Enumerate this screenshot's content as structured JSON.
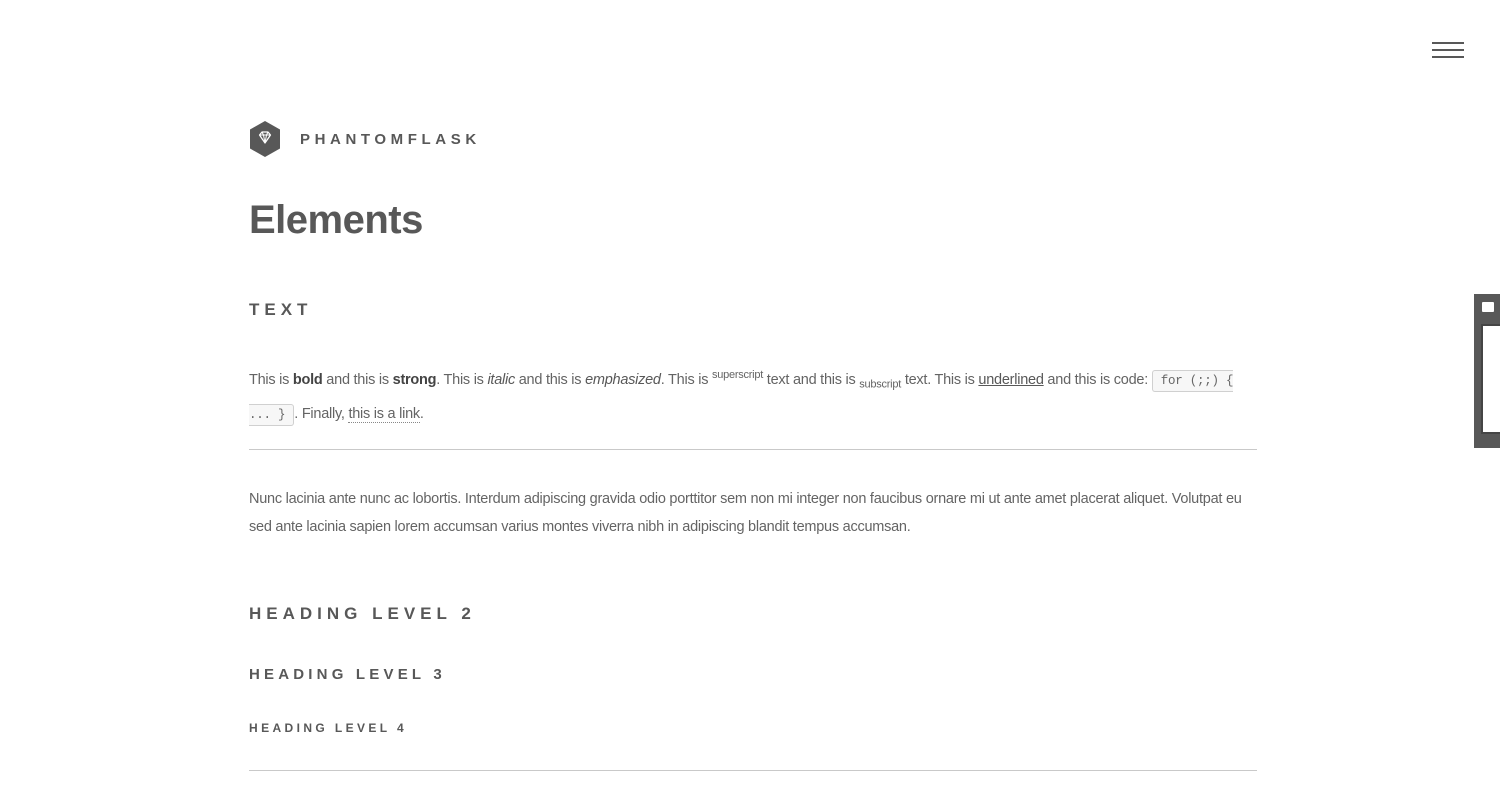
{
  "header": {
    "site_name": "PHANTOMFLASK",
    "logo_icon": "diamond-icon",
    "menu_icon": "hamburger-menu-icon"
  },
  "page_title": "Elements",
  "sections": {
    "text_heading": "TEXT",
    "text_paragraph": {
      "p1": "This is ",
      "bold": "bold",
      "p2": " and this is ",
      "strong": "strong",
      "p3": ". This is ",
      "italic": "italic",
      "p4": " and this is ",
      "emphasized": "emphasized",
      "p5": ". This is ",
      "superscript": "superscript",
      "p6": " text and this is ",
      "subscript": "subscript",
      "p7": " text. This is ",
      "underlined": "underlined",
      "p8": " and this is code: ",
      "code": "for (;;) { ... }",
      "p9": ". Finally, ",
      "link": "this is a link",
      "p10": "."
    },
    "lorem_paragraph": "Nunc lacinia ante nunc ac lobortis. Interdum adipiscing gravida odio porttitor sem non mi integer non faucibus ornare mi ut ante amet placerat aliquet. Volutpat eu sed ante lacinia sapien lorem accumsan varius montes viverra nibh in adipiscing blandit tempus accumsan.",
    "heading_2": "HEADING LEVEL 2",
    "heading_3": "HEADING LEVEL 3",
    "heading_4": "HEADING LEVEL 4"
  },
  "colors": {
    "text": "#585858",
    "body_text": "#646464",
    "rule": "#c9c9c9",
    "background": "#ffffff"
  }
}
